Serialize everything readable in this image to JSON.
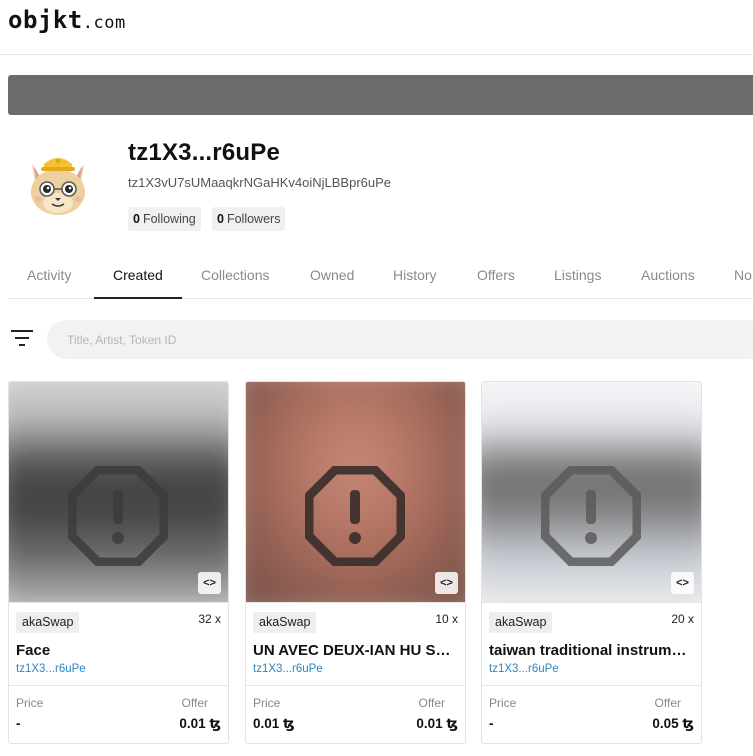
{
  "header": {
    "logo_main": "objkt",
    "logo_suffix": ".com"
  },
  "profile": {
    "alias": "tz1X3...r6uPe",
    "address": "tz1X3vU7sUMaaqkrNGaHKv4oiNjLBBpr6uPe",
    "following_count": "0",
    "following_label": "Following",
    "followers_count": "0",
    "followers_label": "Followers"
  },
  "tabs": [
    "Activity",
    "Created",
    "Collections",
    "Owned",
    "History",
    "Offers",
    "Listings",
    "Auctions",
    "No"
  ],
  "active_tab": "Created",
  "search": {
    "placeholder": "Title, Artist, Token ID"
  },
  "cards": [
    {
      "platform": "akaSwap",
      "edition": "32 x",
      "title": "Face",
      "artist": "tz1X3...r6uPe",
      "price_label": "Price",
      "price": "-",
      "offer_label": "Offer",
      "offer": "0.01 ꜩ",
      "embed_icon": "<>"
    },
    {
      "platform": "akaSwap",
      "edition": "10 x",
      "title": "UN AVEC DEUX-IAN HU SAYS PA",
      "artist": "tz1X3...r6uPe",
      "price_label": "Price",
      "price": "0.01 ꜩ",
      "offer_label": "Offer",
      "offer": "0.01 ꜩ",
      "embed_icon": "<>"
    },
    {
      "platform": "akaSwap",
      "edition": "20 x",
      "title": "taiwan traditional instruments",
      "artist": "tz1X3...r6uPe",
      "price_label": "Price",
      "price": "-",
      "offer_label": "Offer",
      "offer": "0.05 ꜩ",
      "embed_icon": "<>"
    }
  ],
  "colors": {
    "banner": "#6b6b6b",
    "link": "#2e86c1",
    "pill_bg": "#f0f0f0"
  }
}
